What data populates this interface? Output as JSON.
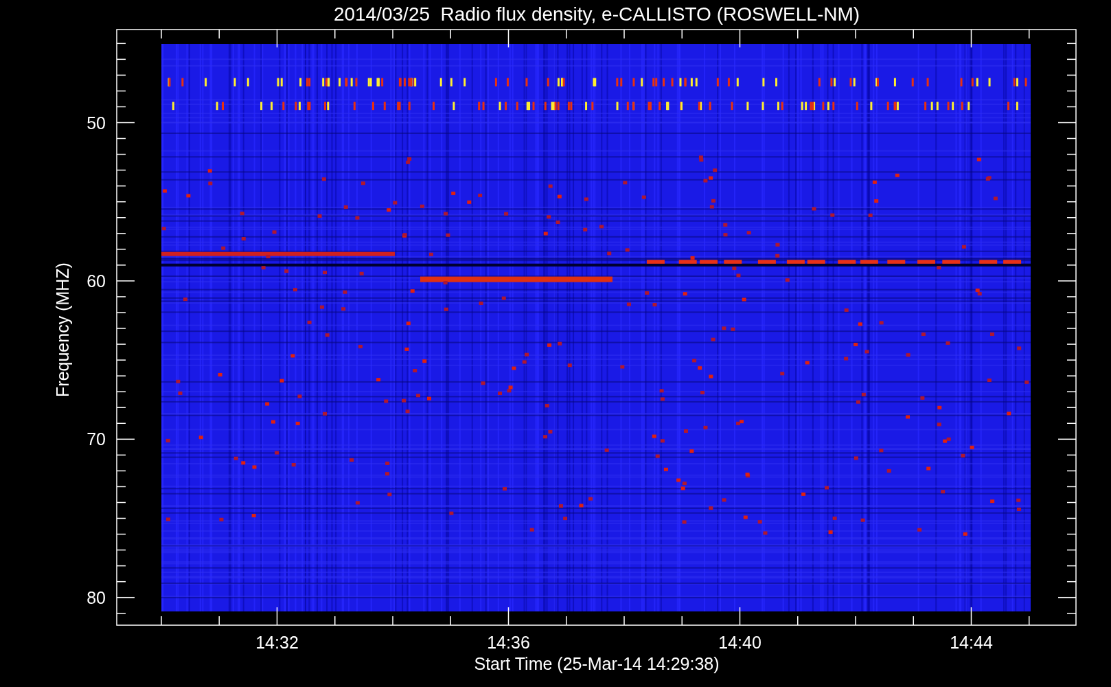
{
  "title": "2014/03/25  Radio flux density, e-CALLISTO (ROSWELL-NM)",
  "y_axis": {
    "label": "Frequency (MHZ)",
    "ticks": [
      "50",
      "60",
      "70",
      "80"
    ]
  },
  "x_axis": {
    "label": "Start Time (25-Mar-14 14:29:38)",
    "ticks": [
      "14:32",
      "14:36",
      "14:40",
      "14:44"
    ]
  }
}
